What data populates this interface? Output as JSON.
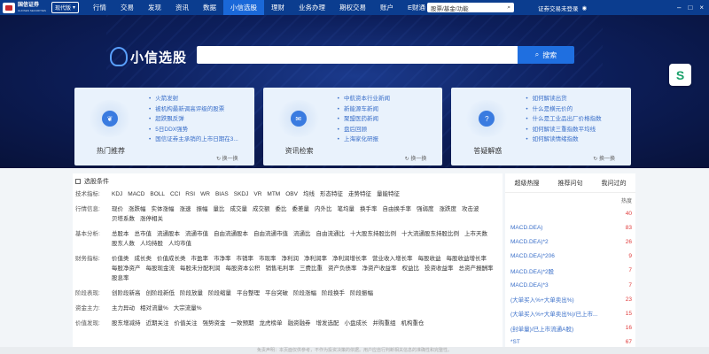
{
  "topnav": {
    "logo_text": "国信证券",
    "logo_sub": "GUOSEN SECURITIES",
    "mode": "现代版",
    "items": [
      "行情",
      "交易",
      "发现",
      "资讯",
      "数据",
      "小信选股",
      "理财",
      "业务办理",
      "期权交易",
      "账户",
      "E财通"
    ],
    "search_placeholder": "股票/基金/功能",
    "login_text": "证券交易未登录",
    "colors": {
      "bar": "#0b3d8f",
      "active": "#1a68d8"
    }
  },
  "banner": {
    "title": "小信选股",
    "search_button": "搜索"
  },
  "cards": [
    {
      "label": "热门推荐",
      "icon": "leaf-icon",
      "items": [
        "火箭发射",
        "被机构最新调高评级的股票",
        "超跌飘反弹",
        "5日DDX强势",
        "国信证券主承销的上市日期在3..."
      ],
      "refresh": "换一换"
    },
    {
      "label": "资讯检索",
      "icon": "news-icon",
      "items": [
        "中航资本行业新闻",
        "新能源车新闻",
        "聚盟医药新闻",
        "盘后回顾",
        "上海家化研报"
      ],
      "refresh": "换一换"
    },
    {
      "label": "答疑解惑",
      "icon": "question-icon",
      "items": [
        "如何解读出货",
        "什么是横元价的",
        "什么是工业品出厂价格指数",
        "如何解读三重指数平均线",
        "如何解读情绪指数"
      ],
      "refresh": "换一换"
    }
  ],
  "conditions": {
    "title": "选股条件",
    "groups": [
      {
        "label": "技术指标:",
        "items": [
          "KDJ",
          "MACD",
          "BOLL",
          "CCI",
          "RSI",
          "WR",
          "BIAS",
          "SKDJ",
          "VR",
          "MTM",
          "OBV",
          "均线",
          "形态特征",
          "走势特征",
          "量能特征"
        ]
      },
      {
        "label": "行情信息:",
        "items": [
          "现价",
          "涨跌幅",
          "实体涨幅",
          "涨速",
          "振幅",
          "量比",
          "成交量",
          "成交额",
          "委比",
          "委差量",
          "内外比",
          "笔均量",
          "换手率",
          "自由换手率",
          "强弱度",
          "涨跌度",
          "攻击波",
          "贝塔系数",
          "涨停相关"
        ]
      },
      {
        "label": "基本分析:",
        "items": [
          "总股本",
          "总市值",
          "流通股本",
          "流通市值",
          "自由流通股本",
          "自由流通市值",
          "流通比",
          "自由流通比",
          "十大股东持股比例",
          "十大流通股东持股比例",
          "上市天数",
          "股东人数",
          "人均持股",
          "人均市值"
        ]
      },
      {
        "label": "财务指标:",
        "items": [
          "价值类",
          "成长类",
          "价值成长类",
          "市盈率",
          "市净率",
          "市销率",
          "市现率",
          "净利润",
          "净利润率",
          "净利润增长率",
          "营业收入增长率",
          "每股收益",
          "每股收益增长率",
          "每股净资产",
          "每股现金流",
          "每股未分配利润",
          "每股资本公积",
          "销售毛利率",
          "三费比重",
          "资产负债率",
          "净资产收益率",
          "权益比",
          "投资收益率",
          "总资产报酬率",
          "股息率"
        ]
      },
      {
        "label": "阶段表现:",
        "items": [
          "创阶段新高",
          "创阶段新低",
          "阶段放量",
          "阶段缩量",
          "平台整理",
          "平台突破",
          "阶段涨幅",
          "阶段换手",
          "阶段振幅"
        ]
      },
      {
        "label": "资金主力:",
        "items": [
          "主力异动",
          "相对流量%",
          "大宗流量%"
        ]
      },
      {
        "label": "价值发现:",
        "items": [
          "股东增减持",
          "近期关注",
          "价值关注",
          "强势资金",
          "一致预期",
          "龙虎榜单",
          "融资融券",
          "增发选配",
          "小盘成长",
          "并购重组",
          "机构重仓"
        ]
      }
    ]
  },
  "ranking": {
    "tabs": [
      "超级热搜",
      "推荐问句",
      "我问过的"
    ],
    "sub_header": "热度",
    "rows": [
      {
        "name": "",
        "value": "40"
      },
      {
        "name": "MACD.DEA)",
        "value": "83"
      },
      {
        "name": "MACD.DEA)*2",
        "value": "26"
      },
      {
        "name": "MACD.DEA)*206",
        "value": "9"
      },
      {
        "name": "MACD.DEA)*2股",
        "value": "7"
      },
      {
        "name": "MACD.DEA)*3",
        "value": "7"
      },
      {
        "name": "(大单买入%+大单卖出%)",
        "value": "23"
      },
      {
        "name": "(大单买入%+大单卖出%)/已上市...",
        "value": "15"
      },
      {
        "name": "(封单量)/已上市流通A股)",
        "value": "16"
      },
      {
        "name": "*ST",
        "value": "67"
      }
    ]
  },
  "footer": "免责声明：本页面仅供参考，不作为投资决策的依据。用户应自行判断相关信息的准确性和完整性。"
}
